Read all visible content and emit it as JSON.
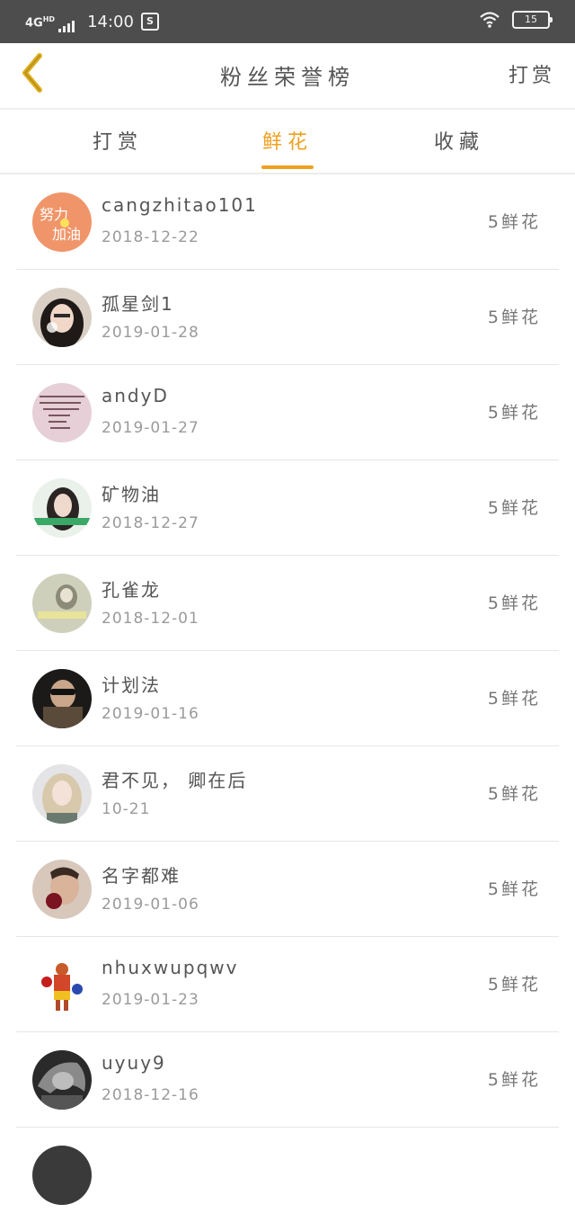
{
  "status_bar": {
    "network": "4G",
    "network_sup": "HD",
    "time": "14:00",
    "app_icon": "S",
    "battery": "15"
  },
  "nav": {
    "title": "粉丝荣誉榜",
    "action": "打赏"
  },
  "tabs": [
    {
      "label": "打赏"
    },
    {
      "label": "鲜花"
    },
    {
      "label": "收藏"
    }
  ],
  "active_tab": "鲜花",
  "accent_color": "#f0a020",
  "fans": [
    {
      "name": "cangzhitao101",
      "date": "2018-12-22",
      "gift": "5鲜花",
      "avatar": "orange-sticker-avatar"
    },
    {
      "name": "孤星剑1",
      "date": "2019-01-28",
      "gift": "5鲜花",
      "avatar": "girl-portrait-avatar"
    },
    {
      "name": "andyD",
      "date": "2019-01-27",
      "gift": "5鲜花",
      "avatar": "pink-text-avatar"
    },
    {
      "name": "矿物油",
      "date": "2018-12-27",
      "gift": "5鲜花",
      "avatar": "woman-green-avatar"
    },
    {
      "name": "孔雀龙",
      "date": "2018-12-01",
      "gift": "5鲜花",
      "avatar": "faded-photo-avatar"
    },
    {
      "name": "计划法",
      "date": "2019-01-16",
      "gift": "5鲜花",
      "avatar": "sunglasses-avatar"
    },
    {
      "name": "君不见， 卿在后",
      "date": "10-21",
      "gift": "5鲜花",
      "avatar": "blonde-girl-avatar"
    },
    {
      "name": "名字都难",
      "date": "2019-01-06",
      "gift": "5鲜花",
      "avatar": "man-rose-avatar"
    },
    {
      "name": "nhuxwupqwv",
      "date": "2019-01-23",
      "gift": "5鲜花",
      "avatar": "boxer-avatar"
    },
    {
      "name": "uyuy9",
      "date": "2018-12-16",
      "gift": "5鲜花",
      "avatar": "warrior-avatar"
    }
  ]
}
